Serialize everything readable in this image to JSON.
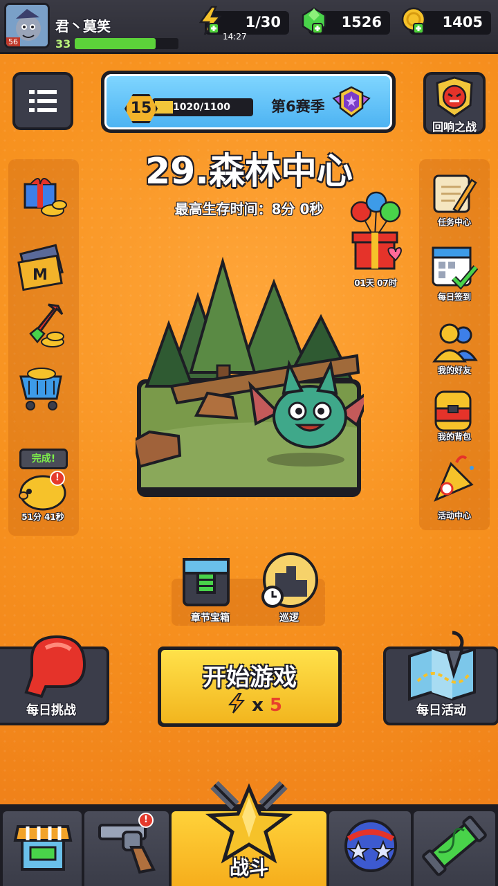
{
  "player": {
    "name": "君丶莫笑",
    "level": "33",
    "avatar_badge": "56",
    "xp_progress": 0.78
  },
  "resources": {
    "energy": "1/30",
    "energy_timer": "14:27",
    "gems": "1526",
    "coins": "1405"
  },
  "season": {
    "level": "15",
    "progress_text": "1020/1100",
    "progress": 0.93,
    "title": "第6赛季"
  },
  "echo_battle": {
    "label": "回响之战"
  },
  "chapter": {
    "title": "29.森林中心",
    "best_survival": "最高生存时间：8分 0秒"
  },
  "gift_timer": "01天 07时",
  "left_side": {
    "piggy_status": "完成!",
    "piggy_timer": "51分 41秒"
  },
  "right_side": [
    {
      "label": "任务中心",
      "icon": "quest-scroll-icon"
    },
    {
      "label": "每日签到",
      "icon": "calendar-icon"
    },
    {
      "label": "我的好友",
      "icon": "friends-icon"
    },
    {
      "label": "我的背包",
      "icon": "backpack-icon"
    },
    {
      "label": "活动中心",
      "icon": "party-popper-icon"
    }
  ],
  "chest": {
    "label": "章节宝箱"
  },
  "patrol": {
    "label": "巡逻"
  },
  "daily_challenge": {
    "label": "每日挑战"
  },
  "daily_event": {
    "label": "每日活动"
  },
  "start": {
    "label": "开始游戏",
    "cost_prefix": "x",
    "cost": "5"
  },
  "nav": {
    "battle_label": "战斗"
  },
  "colors": {
    "accent": "#f38a1f",
    "dark": "#1d1d24",
    "start": "#ffd23a"
  }
}
